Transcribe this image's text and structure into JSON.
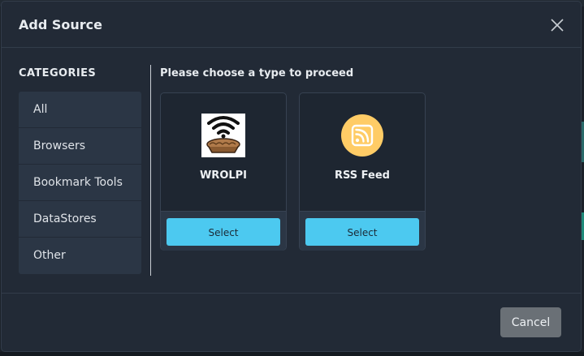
{
  "modal": {
    "title": "Add Source",
    "close_icon": "close-icon"
  },
  "sidebar": {
    "heading": "CATEGORIES",
    "items": [
      {
        "label": "All"
      },
      {
        "label": "Browsers"
      },
      {
        "label": "Bookmark Tools"
      },
      {
        "label": "DataStores"
      },
      {
        "label": "Other"
      }
    ]
  },
  "main": {
    "prompt": "Please choose a type to proceed",
    "cards": [
      {
        "name": "WROLPI",
        "icon": "wifi-pie-logo-icon",
        "select_label": "Select"
      },
      {
        "name": "RSS Feed",
        "icon": "rss-feed-icon",
        "select_label": "Select"
      }
    ]
  },
  "footer": {
    "cancel_label": "Cancel"
  },
  "colors": {
    "accent": "#4cc9f0",
    "rss_orange": "#ffcc66",
    "modal_bg": "#222a36"
  }
}
